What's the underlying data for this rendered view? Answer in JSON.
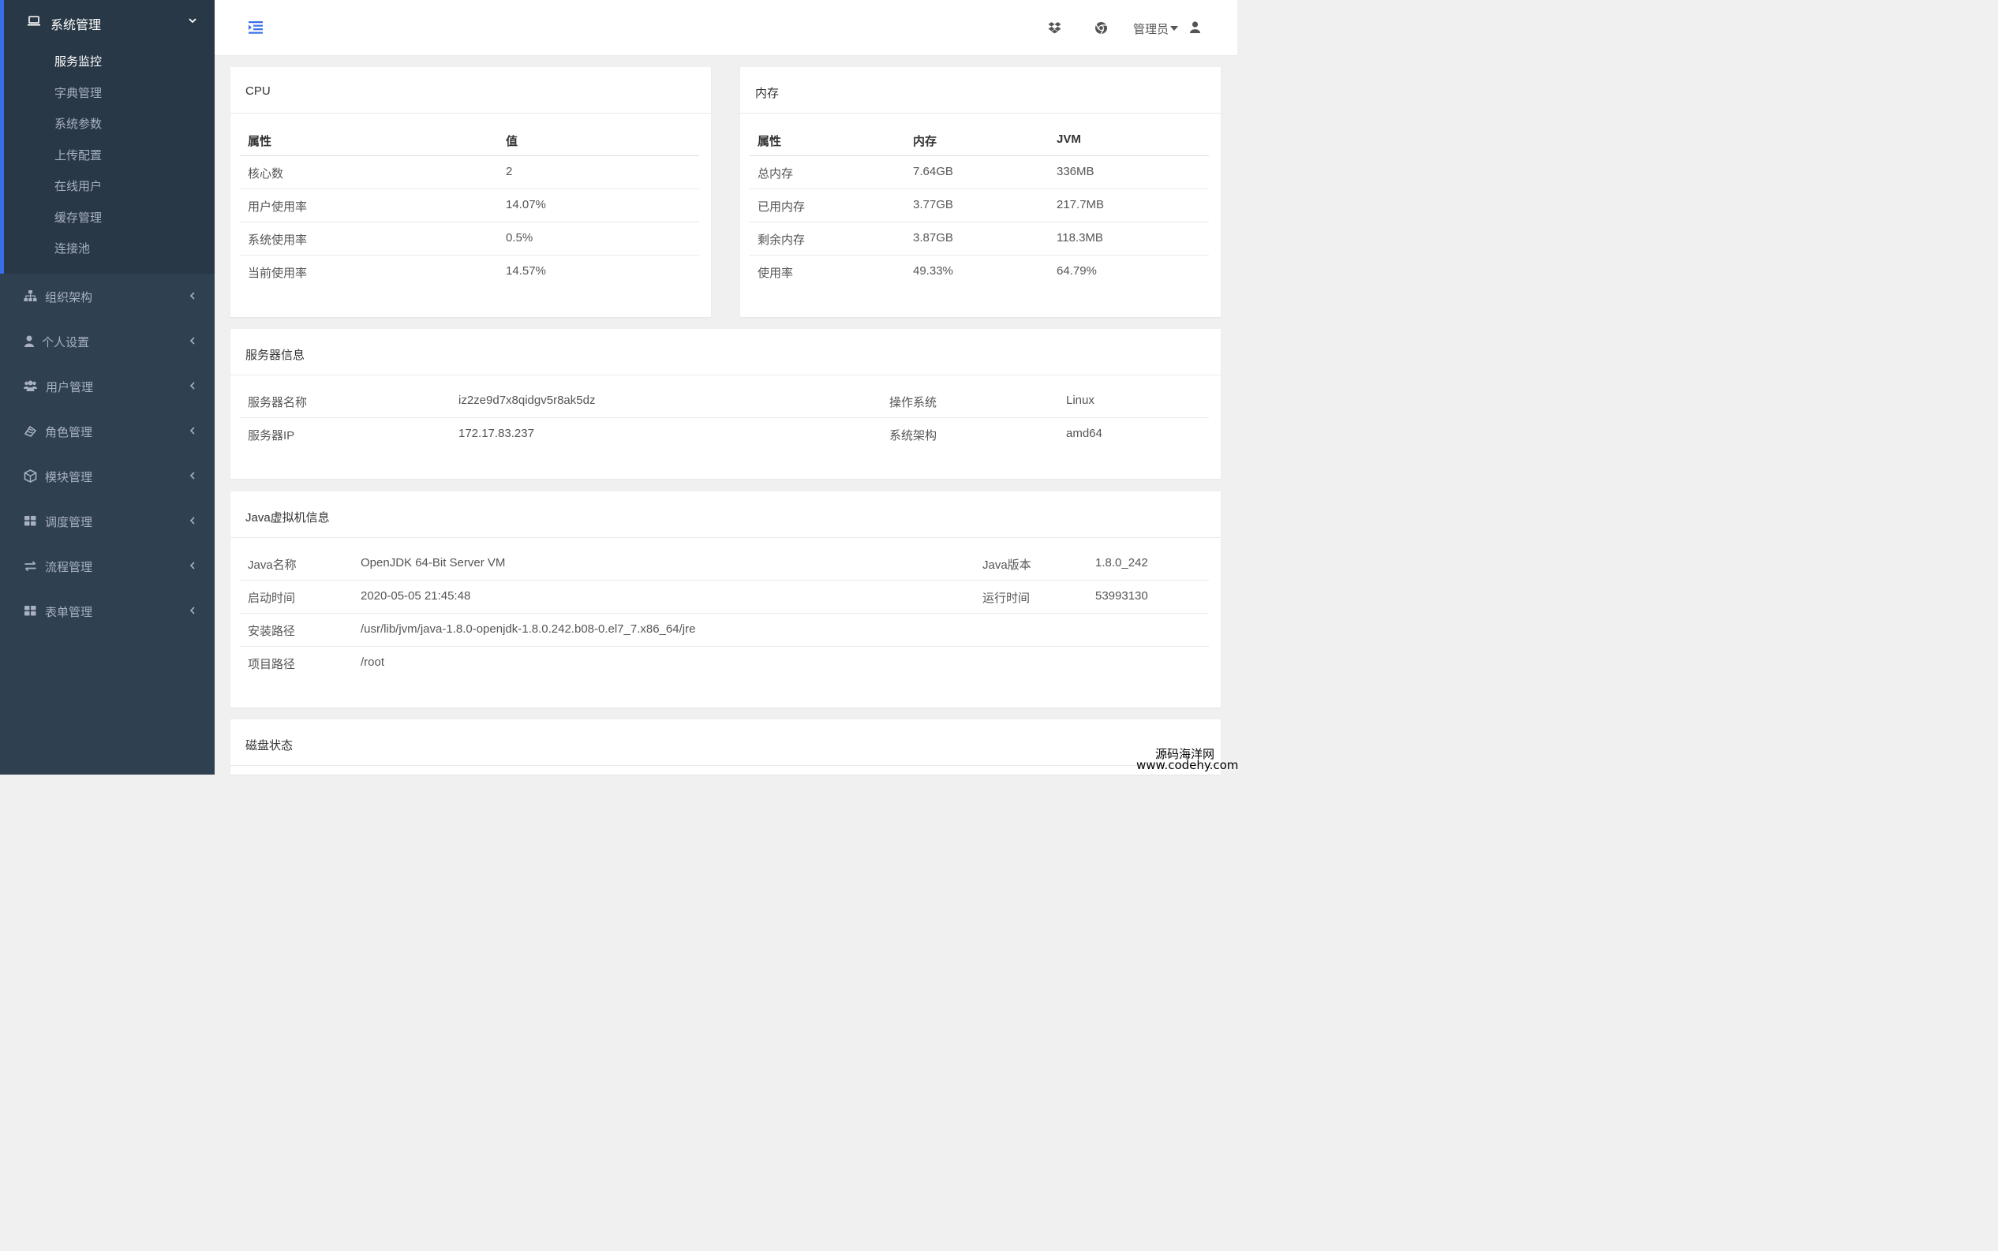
{
  "sidebar": {
    "open_menu": {
      "label": "系统管理",
      "items": [
        "服务监控",
        "字典管理",
        "系统参数",
        "上传配置",
        "在线用户",
        "缓存管理",
        "连接池"
      ]
    },
    "menus": [
      {
        "label": "组织架构",
        "icon": "sitemap-icon"
      },
      {
        "label": "个人设置",
        "icon": "user-icon"
      },
      {
        "label": "用户管理",
        "icon": "users-icon"
      },
      {
        "label": "角色管理",
        "icon": "role-icon"
      },
      {
        "label": "模块管理",
        "icon": "cube-icon"
      },
      {
        "label": "调度管理",
        "icon": "grid-icon"
      },
      {
        "label": "流程管理",
        "icon": "exchange-icon"
      },
      {
        "label": "表单管理",
        "icon": "grid-icon"
      }
    ]
  },
  "header": {
    "user_label": "管理员"
  },
  "cpu": {
    "title": "CPU",
    "headers": [
      "属性",
      "值"
    ],
    "rows": [
      [
        "核心数",
        "2"
      ],
      [
        "用户使用率",
        "14.07%"
      ],
      [
        "系统使用率",
        "0.5%"
      ],
      [
        "当前使用率",
        "14.57%"
      ]
    ]
  },
  "memory": {
    "title": "内存",
    "headers": [
      "属性",
      "内存",
      "JVM"
    ],
    "rows": [
      [
        "总内存",
        "7.64GB",
        "336MB"
      ],
      [
        "已用内存",
        "3.77GB",
        "217.7MB"
      ],
      [
        "剩余内存",
        "3.87GB",
        "118.3MB"
      ],
      [
        "使用率",
        "49.33%",
        "64.79%"
      ]
    ]
  },
  "server": {
    "title": "服务器信息",
    "rows": [
      [
        "服务器名称",
        "iz2ze9d7x8qidgv5r8ak5dz",
        "操作系统",
        "Linux"
      ],
      [
        "服务器IP",
        "172.17.83.237",
        "系统架构",
        "amd64"
      ]
    ]
  },
  "jvm": {
    "title": "Java虚拟机信息",
    "rows": [
      [
        "Java名称",
        "OpenJDK 64-Bit Server VM",
        "Java版本",
        "1.8.0_242"
      ],
      [
        "启动时间",
        "2020-05-05 21:45:48",
        "运行时间",
        "53993130"
      ],
      [
        "安装路径",
        "/usr/lib/jvm/java-1.8.0-openjdk-1.8.0.242.b08-0.el7_7.x86_64/jre"
      ],
      [
        "项目路径",
        "/root"
      ]
    ]
  },
  "disk": {
    "title": "磁盘状态"
  },
  "watermark": {
    "line1": "源码海洋网",
    "line2": "www.codehy.com"
  },
  "colors": {
    "sidebar_bg": "#2f4050",
    "sidebar_active_bg": "#293846",
    "accent": "#3a6ee8"
  }
}
